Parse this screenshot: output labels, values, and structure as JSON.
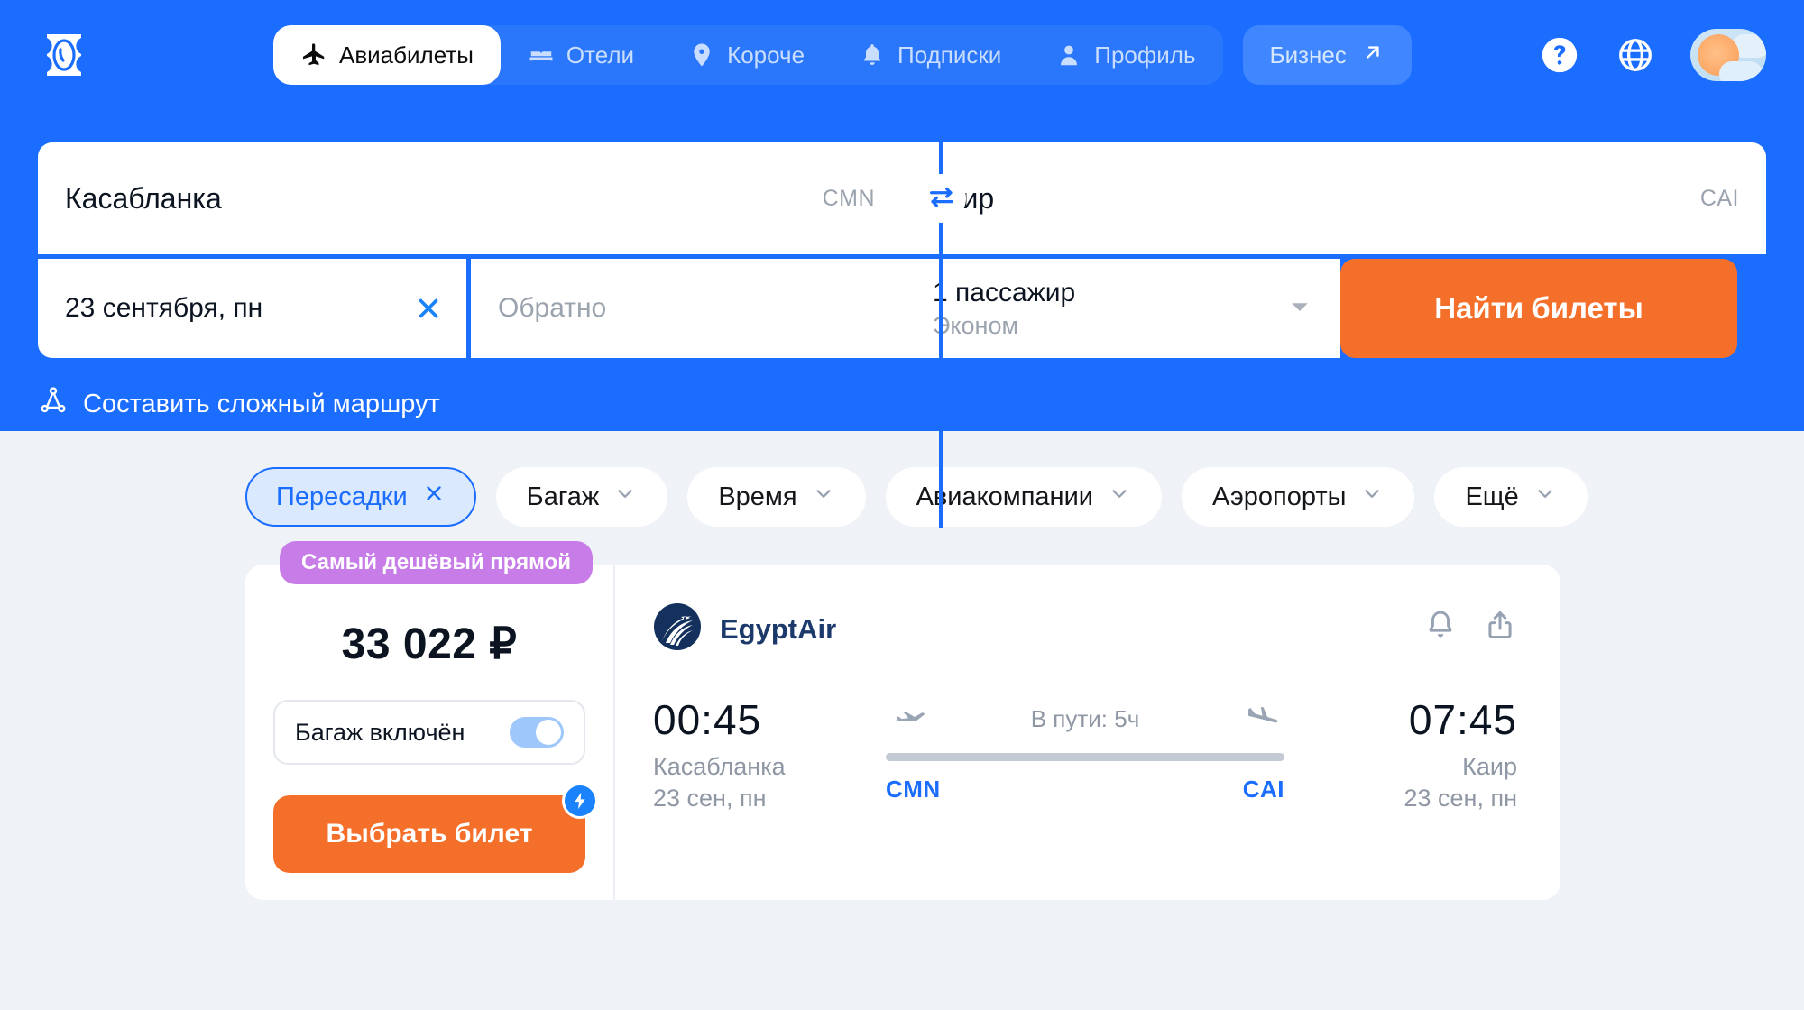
{
  "brand": {
    "primary": "#1a6dfe",
    "accent": "#f4702a",
    "badge": "#c77ce8",
    "link": "#1a6dfe"
  },
  "header": {
    "logo_name": "aviasales-logo-icon",
    "nav": [
      {
        "label": "Авиабилеты",
        "icon": "airplane-icon",
        "active": true
      },
      {
        "label": "Отели",
        "icon": "bed-icon",
        "active": false
      },
      {
        "label": "Короче",
        "icon": "map-pin-icon",
        "active": false
      },
      {
        "label": "Подписки",
        "icon": "bell-icon",
        "active": false
      },
      {
        "label": "Профиль",
        "icon": "person-icon",
        "active": false
      }
    ],
    "business": {
      "label": "Бизнес",
      "icon": "arrow-up-right-icon"
    },
    "help_icon": "question-circle-icon",
    "language_icon": "globe-icon",
    "avatar_icon": "weather-avatar-icon"
  },
  "search": {
    "origin": {
      "value": "Касабланка",
      "code": "CMN"
    },
    "destination": {
      "value": "Каир",
      "code": "CAI"
    },
    "swap_icon": "swap-arrows-icon",
    "depart_date": {
      "value": "23 сентября, пн",
      "clear_icon": "close-icon"
    },
    "return_date": {
      "placeholder": "Обратно"
    },
    "passengers": {
      "count": "1 пассажир",
      "cabin": "Эконом",
      "caret_icon": "chevron-down-icon"
    },
    "submit_label": "Найти билеты",
    "multicity": {
      "label": "Составить сложный маршрут",
      "icon": "multi-city-route-icon"
    }
  },
  "filters": [
    {
      "label": "Пересадки",
      "active": true,
      "icon": "close-icon"
    },
    {
      "label": "Багаж",
      "active": false,
      "icon": "chevron-down-icon"
    },
    {
      "label": "Время",
      "active": false,
      "icon": "chevron-down-icon"
    },
    {
      "label": "Авиакомпании",
      "active": false,
      "icon": "chevron-down-icon"
    },
    {
      "label": "Аэропорты",
      "active": false,
      "icon": "chevron-down-icon"
    },
    {
      "label": "Ещё",
      "active": false,
      "icon": "chevron-down-icon"
    }
  ],
  "ticket": {
    "badge": "Самый дешёвый прямой",
    "price": "33 022 ₽",
    "baggage": {
      "label": "Багаж включён",
      "enabled": true
    },
    "select_label": "Выбрать билет",
    "bolt_icon": "lightning-bolt-icon",
    "airline": {
      "name": "EgyptAir",
      "logo_icon": "egyptair-logo-icon"
    },
    "alert_icon": "bell-icon",
    "share_icon": "share-icon",
    "departure": {
      "time": "00:45",
      "city": "Касабланка",
      "date": "23 сен, пн",
      "code": "CMN",
      "icon": "takeoff-plane-icon"
    },
    "arrival": {
      "time": "07:45",
      "city": "Каир",
      "date": "23 сен, пн",
      "code": "CAI",
      "icon": "landing-plane-icon"
    },
    "duration": "В пути: 5ч"
  }
}
